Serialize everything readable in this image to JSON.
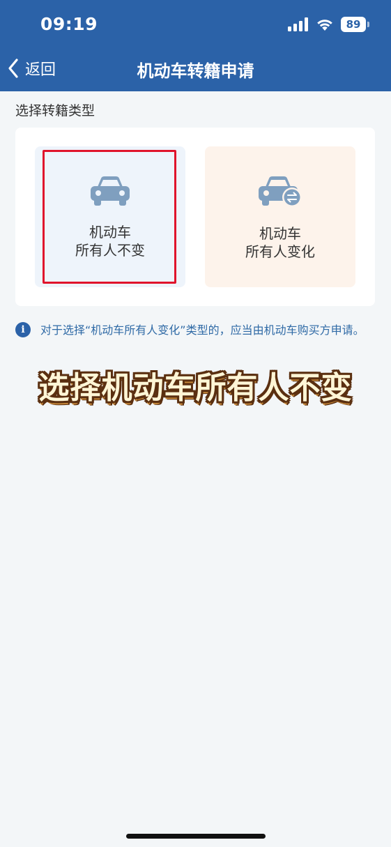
{
  "status_bar": {
    "time": "09:19",
    "battery": "89"
  },
  "nav": {
    "back_label": "返回",
    "title": "机动车转籍申请"
  },
  "section_label": "选择转籍类型",
  "options": [
    {
      "line1": "机动车",
      "line2": "所有人不变",
      "icon": "car-icon",
      "selected": true
    },
    {
      "line1": "机动车",
      "line2": "所有人变化",
      "icon": "car-transfer-icon",
      "selected": false
    }
  ],
  "info": {
    "icon": "info-icon",
    "glyph": "i",
    "text": "对于选择“机动车所有人变化”类型的，应当由机动车购买方申请。"
  },
  "overlay_caption": "选择机动车所有人不变",
  "colors": {
    "brand_blue": "#2b62a8",
    "highlight_red": "#e0142c",
    "info_text": "#2f6aa6",
    "option_a_bg": "#eef4fb",
    "option_b_bg": "#fdf3eb",
    "car_icon": "#7f9fbf"
  }
}
